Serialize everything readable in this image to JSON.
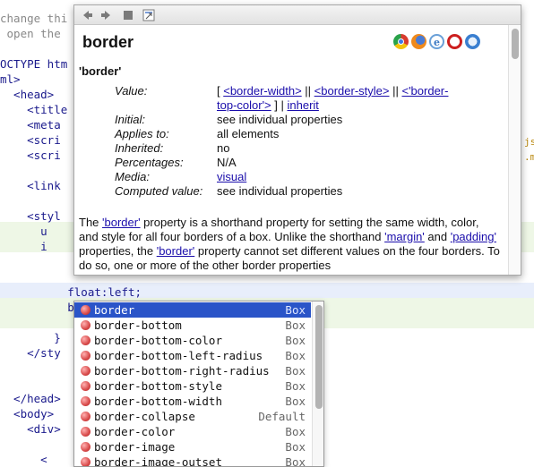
{
  "editor": {
    "lines": [
      {
        "text": "change thi",
        "kind": "comment"
      },
      {
        "text": " open the ",
        "kind": "comment"
      },
      {
        "text": "",
        "kind": "blank"
      },
      {
        "text": "OCTYPE htm",
        "kind": "tag"
      },
      {
        "text": "ml>",
        "kind": "tag"
      },
      {
        "text": "  <head>",
        "kind": "tag"
      },
      {
        "text": "    <title",
        "kind": "tag"
      },
      {
        "text": "    <meta",
        "kind": "tag"
      },
      {
        "text": "    <scri",
        "kind": "tag"
      },
      {
        "text": "    <scri",
        "kind": "tag"
      },
      {
        "text": "",
        "kind": "blank"
      },
      {
        "text": "    <link",
        "kind": "tag"
      },
      {
        "text": "",
        "kind": "blank"
      },
      {
        "text": "    <styl",
        "kind": "tag"
      },
      {
        "text": "      u",
        "kind": "prop"
      },
      {
        "text": "      i",
        "kind": "prop"
      },
      {
        "text": "",
        "kind": "blank"
      },
      {
        "text": "",
        "kind": "blank"
      },
      {
        "text": "          float:left;",
        "kind": "prop"
      },
      {
        "text": "          bord",
        "kind": "prop"
      },
      {
        "text": "",
        "kind": "blank"
      },
      {
        "text": "        }",
        "kind": "prop"
      },
      {
        "text": "    </sty",
        "kind": "tag"
      },
      {
        "text": "",
        "kind": "blank"
      },
      {
        "text": "",
        "kind": "blank"
      },
      {
        "text": "  </head>",
        "kind": "tag"
      },
      {
        "text": "  <body>",
        "kind": "tag"
      },
      {
        "text": "    <div>",
        "kind": "tag"
      },
      {
        "text": "",
        "kind": "blank"
      },
      {
        "text": "      <",
        "kind": "tag"
      },
      {
        "text": "      <",
        "kind": "tag"
      }
    ],
    "right_fragments": [
      "js",
      ".m"
    ]
  },
  "toolbar": {
    "back_icon": "back-arrow-icon",
    "forward_icon": "forward-arrow-icon",
    "stop_icon": "stop-icon",
    "external_icon": "open-in-browser-icon"
  },
  "doc": {
    "title": "border",
    "browsers": [
      "chrome",
      "firefox",
      "ie",
      "opera",
      "safari"
    ],
    "prop_name": "'border'",
    "rows": [
      {
        "label": "Value:",
        "value_parts": [
          {
            "text": "[ ",
            "link": false
          },
          {
            "text": "<border-width>",
            "link": true
          },
          {
            "text": " || ",
            "link": false
          },
          {
            "text": "<border-style>",
            "link": true
          },
          {
            "text": " || ",
            "link": false
          },
          {
            "text": "<'border-",
            "link": true
          }
        ],
        "value_line2": [
          {
            "text": "top-color'>",
            "link": true
          },
          {
            "text": " ] | ",
            "link": false
          },
          {
            "text": "inherit",
            "link": true
          }
        ]
      },
      {
        "label": "Initial:",
        "value": "see individual properties"
      },
      {
        "label": "Applies to:",
        "value": "all elements"
      },
      {
        "label": "Inherited:",
        "value": "no"
      },
      {
        "label": "Percentages:",
        "value": "N/A"
      },
      {
        "label": "Media:",
        "value": "visual",
        "link": true
      },
      {
        "label": "Computed value:",
        "value": "see individual properties"
      }
    ],
    "description": [
      {
        "text": "The ",
        "link": false
      },
      {
        "text": "'border'",
        "link": true
      },
      {
        "text": " property is a shorthand property for setting the same width, color, and style for all four borders of a box. Unlike the shorthand ",
        "link": false
      },
      {
        "text": "'margin'",
        "link": true
      },
      {
        "text": " and ",
        "link": false
      },
      {
        "text": "'padding'",
        "link": true
      },
      {
        "text": " properties, the ",
        "link": false
      },
      {
        "text": "'border'",
        "link": true
      },
      {
        "text": " property cannot set different values on the four borders. To do so, one or more of the other border properties",
        "link": false
      }
    ]
  },
  "autocomplete": {
    "items": [
      {
        "label": "border",
        "type": "Box",
        "selected": true
      },
      {
        "label": "border-bottom",
        "type": "Box"
      },
      {
        "label": "border-bottom-color",
        "type": "Box"
      },
      {
        "label": "border-bottom-left-radius",
        "type": "Box"
      },
      {
        "label": "border-bottom-right-radius",
        "type": "Box"
      },
      {
        "label": "border-bottom-style",
        "type": "Box"
      },
      {
        "label": "border-bottom-width",
        "type": "Box"
      },
      {
        "label": "border-collapse",
        "type": "Default"
      },
      {
        "label": "border-color",
        "type": "Box"
      },
      {
        "label": "border-image",
        "type": "Box"
      },
      {
        "label": "border-image-outset",
        "type": "Box"
      }
    ]
  },
  "colors": {
    "selection": "#2a54c8",
    "link": "#1a0dab",
    "line_highlight_green": "#eef7e6",
    "line_highlight_blue": "#e8eefb"
  }
}
